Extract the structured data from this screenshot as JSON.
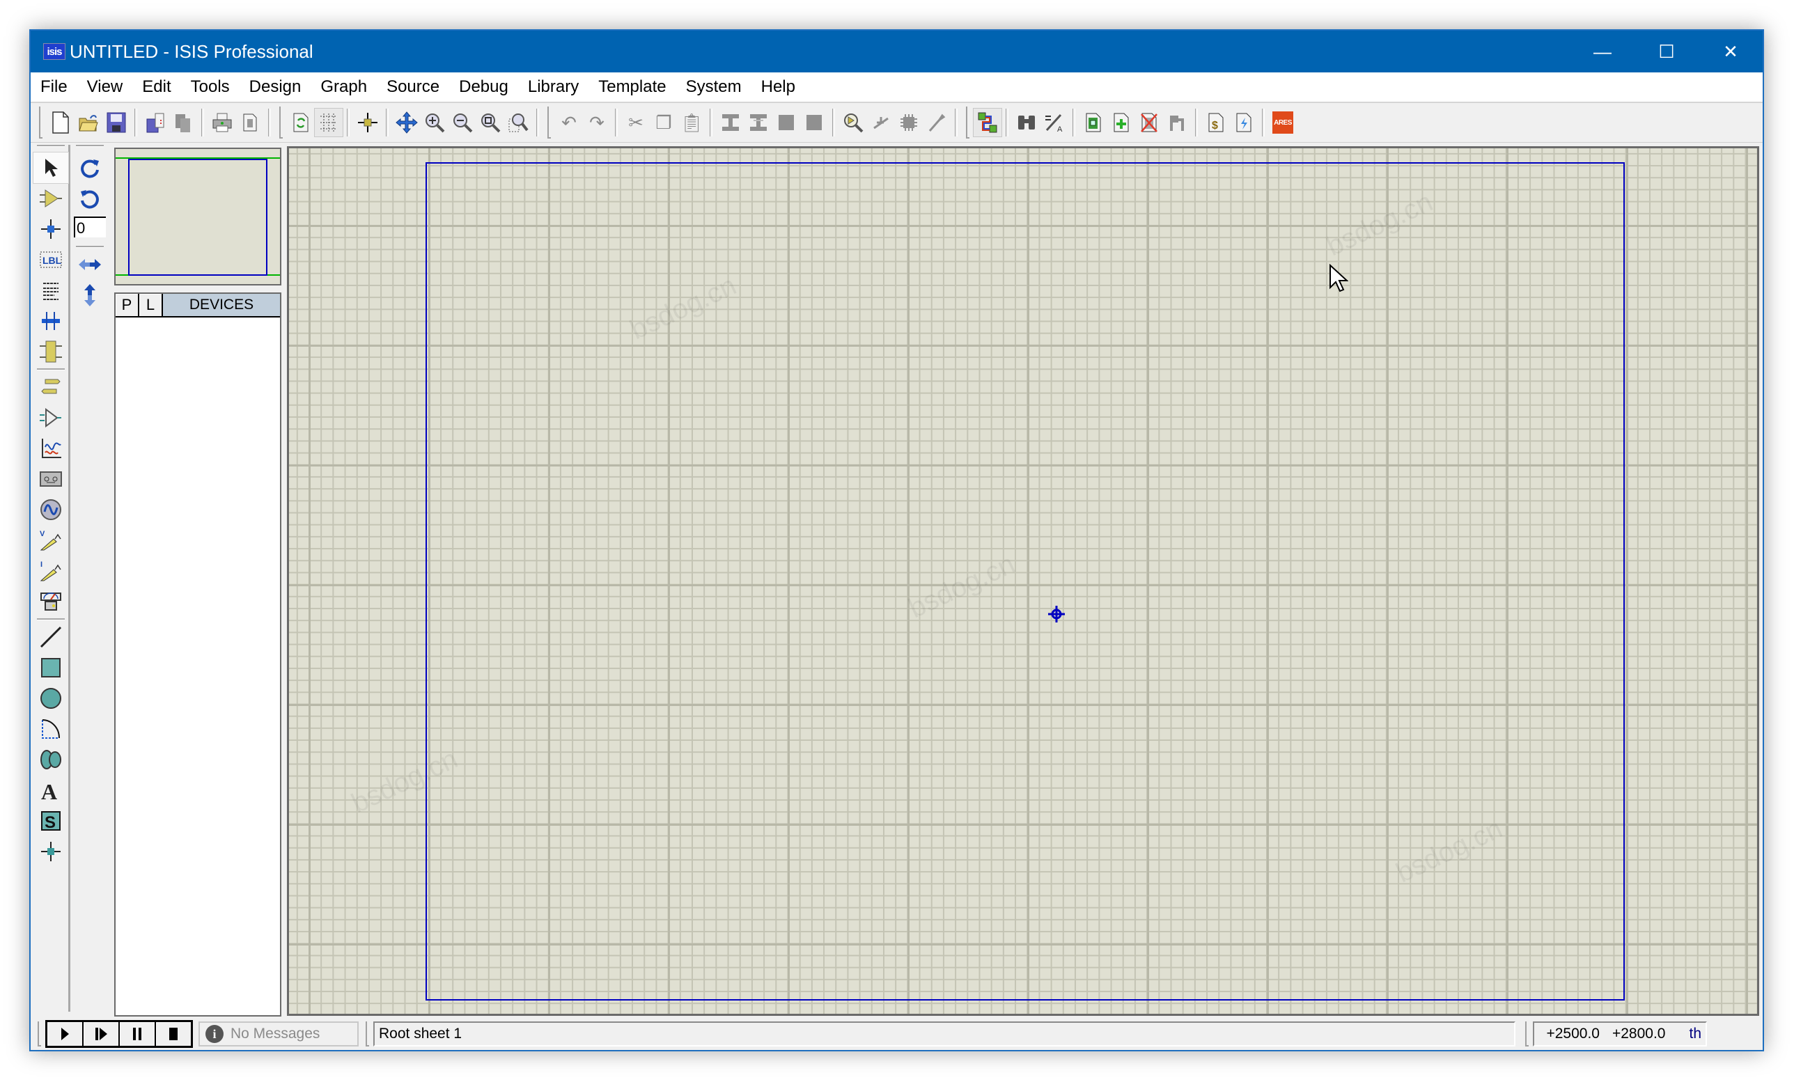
{
  "window": {
    "app_icon": "isis",
    "title": "UNTITLED - ISIS Professional",
    "controls": {
      "minimize": "—",
      "maximize": "☐",
      "close": "✕"
    }
  },
  "menu": [
    "File",
    "View",
    "Edit",
    "Tools",
    "Design",
    "Graph",
    "Source",
    "Debug",
    "Library",
    "Template",
    "System",
    "Help"
  ],
  "toolbar": {
    "groups": [
      [
        "new-file-icon",
        "open-folder-icon",
        "save-icon"
      ],
      [
        "import-section-icon",
        "export-section-icon"
      ],
      [
        "print-icon",
        "print-area-icon"
      ],
      [
        "refresh-icon",
        "grid-icon"
      ],
      [
        "origin-icon"
      ],
      [
        "pan-icon",
        "zoom-in-icon",
        "zoom-out-icon",
        "zoom-all-icon",
        "zoom-area-icon"
      ],
      [
        "undo-icon",
        "redo-icon"
      ],
      [
        "cut-icon",
        "copy-icon",
        "paste-icon"
      ],
      [
        "block-copy-icon",
        "block-move-icon",
        "block-rotate-icon",
        "block-delete-icon"
      ],
      [
        "pick-device-icon",
        "make-device-icon",
        "packaging-tool-icon",
        "decompose-icon"
      ],
      [
        "wire-autorouter-icon"
      ],
      [
        "search-tag-icon",
        "property-assignment-icon"
      ],
      [
        "design-explorer-icon",
        "new-sheet-icon",
        "remove-sheet-icon",
        "exit-to-parent-icon"
      ],
      [
        "bill-of-materials-icon",
        "electrical-rules-check-icon"
      ],
      [
        "netlist-to-ares-icon"
      ]
    ],
    "ares_label": "ARES"
  },
  "mode_tools": [
    "selection-mode",
    "component-mode",
    "junction-dot-mode",
    "wire-label-mode",
    "text-script-mode",
    "buses-mode",
    "subcircuit-mode",
    "|",
    "terminals-mode",
    "device-pins-mode",
    "graph-mode",
    "tape-recorder-mode",
    "generator-mode",
    "voltage-probe-mode",
    "current-probe-mode",
    "virtual-instruments-mode",
    "|",
    "2d-line-mode",
    "2d-box-mode",
    "2d-circle-mode",
    "2d-arc-mode",
    "2d-path-mode",
    "2d-text-mode",
    "2d-symbol-mode",
    "2d-markers-mode"
  ],
  "orientation": {
    "rotate_cw": "rotate-clockwise",
    "rotate_ccw": "rotate-anticlockwise",
    "angle_value": "0",
    "mirror_x": "mirror-horizontal",
    "mirror_y": "mirror-vertical"
  },
  "devices_panel": {
    "pick_button": "P",
    "library_button": "L",
    "title": "DEVICES",
    "items": []
  },
  "status": {
    "sim_controls": [
      "play",
      "step",
      "pause",
      "stop"
    ],
    "messages": "No Messages",
    "sheet": "Root sheet 1",
    "coord_x": "+2500.0",
    "coord_y": "+2800.0",
    "units": "th"
  },
  "colors": {
    "titlebar": "#0063b1",
    "canvas_bg": "#e0e0d2",
    "grid_major": "#b8b8a8",
    "sheet_border": "#0000c0",
    "devices_header": "#c0cedb"
  },
  "watermark": "bsdog.cn"
}
